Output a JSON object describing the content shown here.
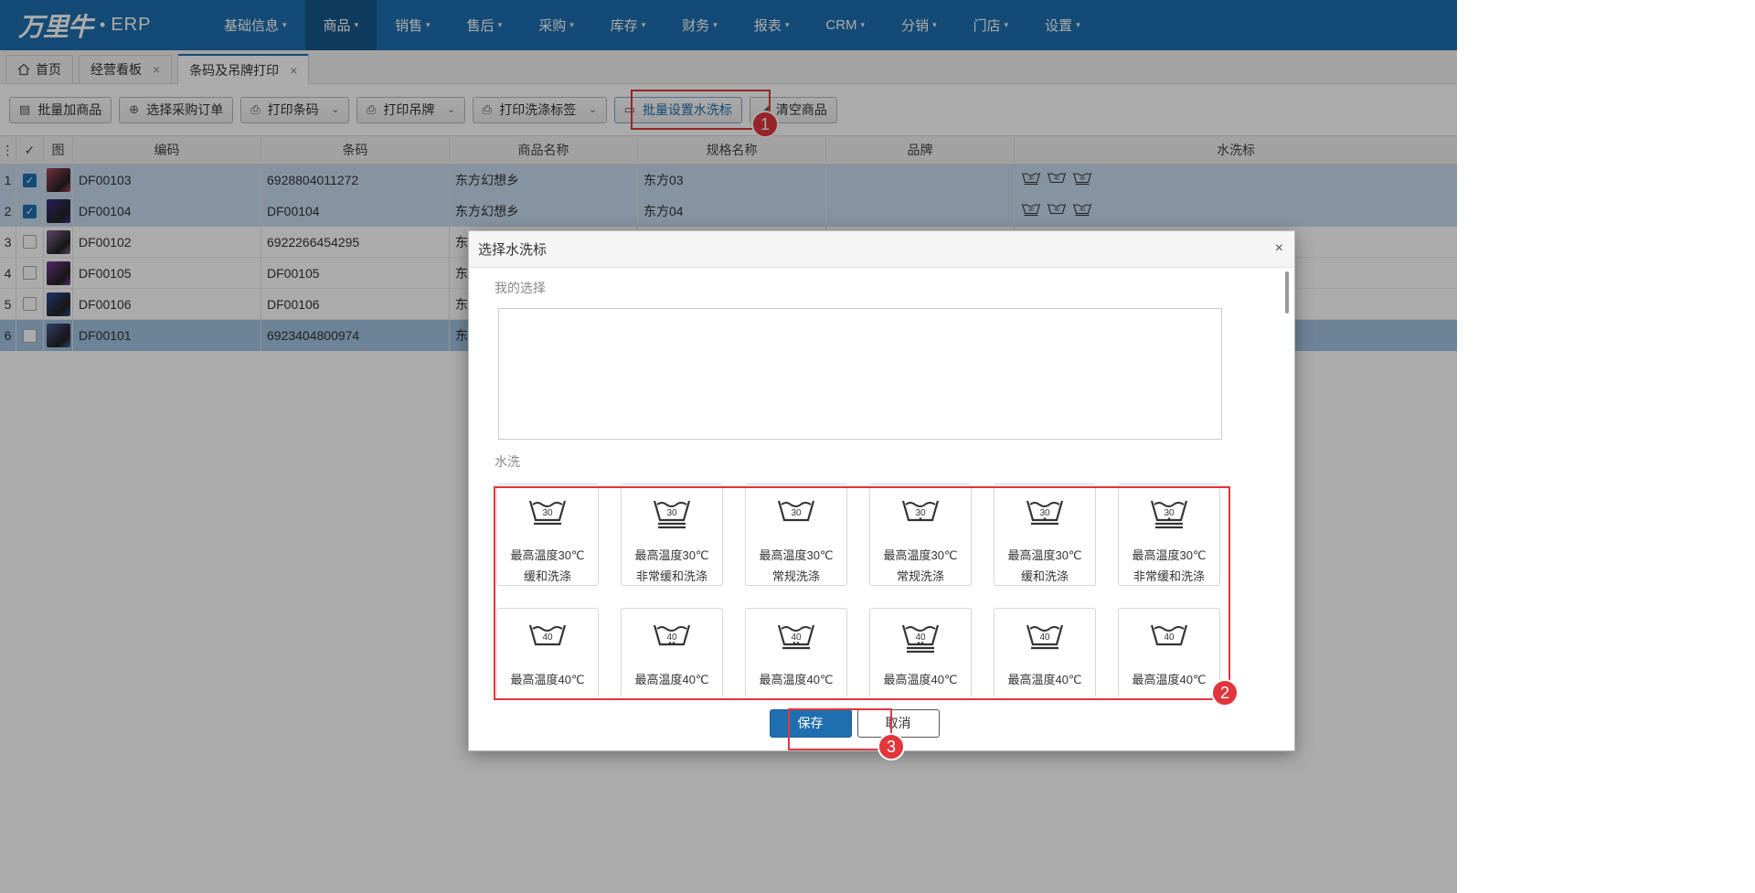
{
  "app": {
    "logo_text": "万里牛",
    "logo_suffix": "ERP"
  },
  "nav": {
    "items": [
      "基础信息",
      "商品",
      "销售",
      "售后",
      "采购",
      "库存",
      "财务",
      "报表",
      "CRM",
      "分销",
      "门店",
      "设置"
    ],
    "active_index": 1
  },
  "tabs": [
    {
      "label": "首页",
      "closable": false
    },
    {
      "label": "经营看板",
      "closable": true
    },
    {
      "label": "条码及吊牌打印",
      "closable": true,
      "active": true
    }
  ],
  "toolbar": {
    "batch_add": "批量加商品",
    "select_po": "选择采购订单",
    "print_barcode": "打印条码",
    "print_tag": "打印吊牌",
    "print_wash_label": "打印洗涤标签",
    "batch_wash": "批量设置水洗标",
    "clear": "清空商品"
  },
  "grid": {
    "headers": [
      "",
      "",
      "图",
      "编码",
      "条码",
      "商品名称",
      "规格名称",
      "品牌",
      "水洗标"
    ],
    "rows": [
      {
        "no": "1",
        "checked": true,
        "code": "DF00103",
        "barcode": "6928804011272",
        "name": "东方幻想乡",
        "spec": "东方03",
        "brand": "",
        "wash": true,
        "thumb_color": "#b0485a"
      },
      {
        "no": "2",
        "checked": true,
        "code": "DF00104",
        "barcode": "DF00104",
        "name": "东方幻想乡",
        "spec": "东方04",
        "brand": "",
        "wash": true,
        "thumb_color": "#3b2f8a"
      },
      {
        "no": "3",
        "checked": false,
        "code": "DF00102",
        "barcode": "6922266454295",
        "name": "东",
        "spec": "",
        "brand": "",
        "wash": false,
        "thumb_color": "#8a6aa0"
      },
      {
        "no": "4",
        "checked": false,
        "code": "DF00105",
        "barcode": "DF00105",
        "name": "东",
        "spec": "",
        "brand": "",
        "wash": false,
        "thumb_color": "#7a3c9a"
      },
      {
        "no": "5",
        "checked": false,
        "code": "DF00106",
        "barcode": "DF00106",
        "name": "东",
        "spec": "",
        "brand": "",
        "wash": false,
        "thumb_color": "#2c4f9e"
      },
      {
        "no": "6",
        "checked": false,
        "code": "DF00101",
        "barcode": "6923404800974",
        "name": "东",
        "spec": "",
        "brand": "",
        "wash": false,
        "thumb_color": "#4a5a9a"
      }
    ]
  },
  "dialog": {
    "title": "选择水洗标",
    "my_selection_label": "我的选择",
    "wash_section_label": "水洗",
    "cards": [
      {
        "temp": "30",
        "line1": "最高温度30℃",
        "line2": "缓和洗涤",
        "bars": 1,
        "dots": 0
      },
      {
        "temp": "30",
        "line1": "最高温度30℃",
        "line2": "非常缓和洗涤",
        "bars": 2,
        "dots": 0
      },
      {
        "temp": "30",
        "line1": "最高温度30℃",
        "line2": "常规洗涤",
        "bars": 0,
        "dots": 0
      },
      {
        "temp": "30",
        "line1": "最高温度30℃",
        "line2": "常规洗涤",
        "bars": 0,
        "dots": 1
      },
      {
        "temp": "30",
        "line1": "最高温度30℃",
        "line2": "缓和洗涤",
        "bars": 1,
        "dots": 1
      },
      {
        "temp": "30",
        "line1": "最高温度30℃",
        "line2": "非常缓和洗涤",
        "bars": 2,
        "dots": 1
      },
      {
        "temp": "40",
        "line1": "最高温度40℃",
        "line2": "",
        "bars": 0,
        "dots": 0
      },
      {
        "temp": "40",
        "line1": "最高温度40℃",
        "line2": "",
        "bars": 0,
        "dots": 2
      },
      {
        "temp": "40",
        "line1": "最高温度40℃",
        "line2": "",
        "bars": 1,
        "dots": 2
      },
      {
        "temp": "40",
        "line1": "最高温度40℃",
        "line2": "",
        "bars": 2,
        "dots": 2
      },
      {
        "temp": "40",
        "line1": "最高温度40℃",
        "line2": "",
        "bars": 1,
        "dots": 0
      },
      {
        "temp": "40",
        "line1": "最高温度40℃",
        "line2": "",
        "bars": 0,
        "dots": 0
      }
    ],
    "save": "保存",
    "cancel": "取消"
  },
  "annotations": [
    "1",
    "2",
    "3"
  ],
  "colors": {
    "nav_bg": "#1f6fb0",
    "accent": "#1f6fb0",
    "annotation_red": "#e0363c"
  }
}
